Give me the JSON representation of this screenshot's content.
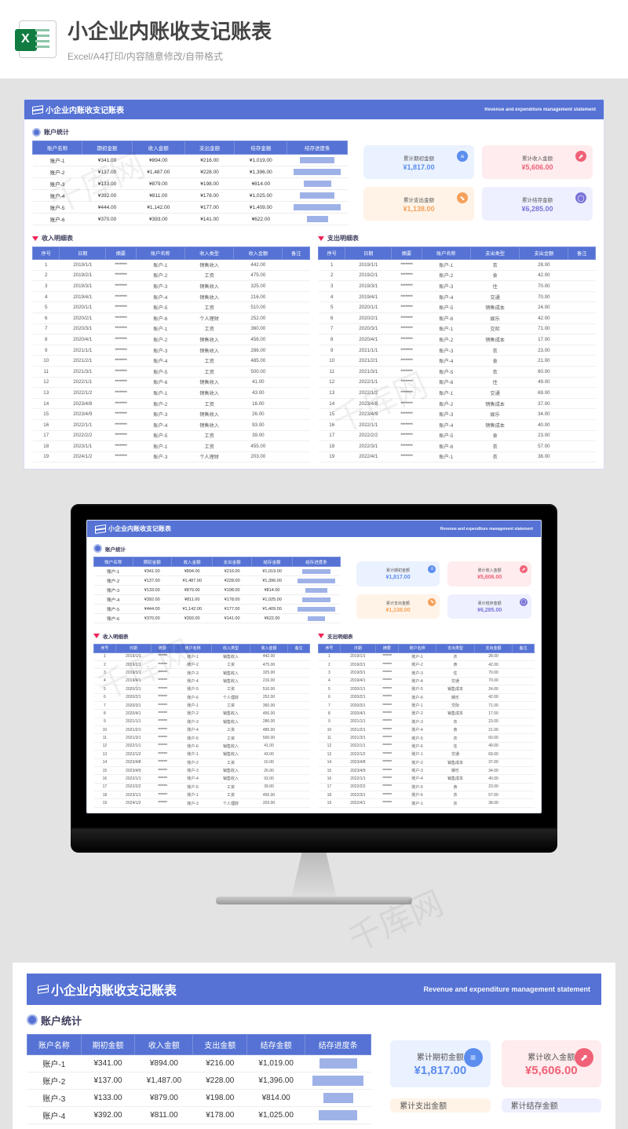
{
  "page": {
    "title": "小企业内账收支记账表",
    "subtitle": "Excel/A4打印/内容随意修改/自带格式",
    "watermark": "千库网"
  },
  "sheet": {
    "title": "小企业内账收支记账表",
    "title_en": "Revenue and expenditure management statement",
    "sect_acct": "账户统计",
    "sect_income": "收入明细表",
    "sect_expense": "支出明细表"
  },
  "acct": {
    "headers": [
      "账户名称",
      "期初金额",
      "收入金额",
      "支出金额",
      "结存金额",
      "结存进度条"
    ],
    "rows": [
      {
        "name": "账户-1",
        "a": "¥341.00",
        "b": "¥894.00",
        "c": "¥216.00",
        "d": "¥1,019.00",
        "bar": 60
      },
      {
        "name": "账户-2",
        "a": "¥137.00",
        "b": "¥1,487.00",
        "c": "¥228.00",
        "d": "¥1,396.00",
        "bar": 82
      },
      {
        "name": "账户-3",
        "a": "¥133.00",
        "b": "¥879.00",
        "c": "¥198.00",
        "d": "¥814.00",
        "bar": 48
      },
      {
        "name": "账户-4",
        "a": "¥392.00",
        "b": "¥811.00",
        "c": "¥178.00",
        "d": "¥1,025.00",
        "bar": 61
      },
      {
        "name": "账户-5",
        "a": "¥444.00",
        "b": "¥1,142.00",
        "c": "¥177.00",
        "d": "¥1,409.00",
        "bar": 83
      },
      {
        "name": "账户-6",
        "a": "¥370.00",
        "b": "¥393.00",
        "c": "¥141.00",
        "d": "¥622.00",
        "bar": 37
      }
    ]
  },
  "cards": [
    {
      "label": "累计期初金额",
      "value": "¥1,817.00",
      "icon": "≡"
    },
    {
      "label": "累计收入金额",
      "value": "¥5,606.00",
      "icon": "⬈"
    },
    {
      "label": "累计支出金额",
      "value": "¥1,138.00",
      "icon": "⬊"
    },
    {
      "label": "累计结存金额",
      "value": "¥6,285.00",
      "icon": "◯"
    }
  ],
  "income": {
    "headers": [
      "序号",
      "日期",
      "摘要",
      "账户名称",
      "收入类型",
      "收入金额",
      "备注"
    ],
    "rows": [
      {
        "n": 1,
        "d": "2019/1/1",
        "a": "账户-1",
        "t": "销售收入",
        "v": "442.00"
      },
      {
        "n": 2,
        "d": "2019/2/1",
        "a": "账户-2",
        "t": "工资",
        "v": "475.00"
      },
      {
        "n": 3,
        "d": "2019/3/1",
        "a": "账户-3",
        "t": "销售收入",
        "v": "325.00"
      },
      {
        "n": 4,
        "d": "2019/4/1",
        "a": "账户-4",
        "t": "销售收入",
        "v": "216.00"
      },
      {
        "n": 5,
        "d": "2020/1/1",
        "a": "账户-5",
        "t": "工资",
        "v": "510.00"
      },
      {
        "n": 6,
        "d": "2020/2/1",
        "a": "账户-6",
        "t": "个人理财",
        "v": "252.00"
      },
      {
        "n": 7,
        "d": "2020/3/1",
        "a": "账户-1",
        "t": "工资",
        "v": "360.00"
      },
      {
        "n": 8,
        "d": "2020/4/1",
        "a": "账户-2",
        "t": "销售收入",
        "v": "456.00"
      },
      {
        "n": 9,
        "d": "2021/1/1",
        "a": "账户-3",
        "t": "销售收入",
        "v": "286.00"
      },
      {
        "n": 10,
        "d": "2021/2/1",
        "a": "账户-4",
        "t": "工资",
        "v": "485.00"
      },
      {
        "n": 11,
        "d": "2021/3/1",
        "a": "账户-5",
        "t": "工资",
        "v": "500.00"
      },
      {
        "n": 12,
        "d": "2022/1/1",
        "a": "账户-6",
        "t": "销售收入",
        "v": "41.00"
      },
      {
        "n": 13,
        "d": "2022/1/2",
        "a": "账户-1",
        "t": "销售收入",
        "v": "43.00"
      },
      {
        "n": 14,
        "d": "2023/4/8",
        "a": "账户-2",
        "t": "工资",
        "v": "16.00"
      },
      {
        "n": 15,
        "d": "2023/4/9",
        "a": "账户-3",
        "t": "销售收入",
        "v": "26.00"
      },
      {
        "n": 16,
        "d": "2022/1/1",
        "a": "账户-4",
        "t": "销售收入",
        "v": "93.00"
      },
      {
        "n": 17,
        "d": "2022/2/2",
        "a": "账户-5",
        "t": "工资",
        "v": "39.00"
      },
      {
        "n": 18,
        "d": "2023/1/1",
        "a": "账户-1",
        "t": "工资",
        "v": "455.00"
      },
      {
        "n": 19,
        "d": "2024/1/2",
        "a": "账户-3",
        "t": "个人理财",
        "v": "203.00"
      }
    ]
  },
  "expense": {
    "headers": [
      "序号",
      "日期",
      "摘要",
      "账户名称",
      "支出类型",
      "支出金额",
      "备注"
    ],
    "rows": [
      {
        "n": 1,
        "d": "2019/1/1",
        "a": "账户-1",
        "t": "衣",
        "v": "28.00"
      },
      {
        "n": 2,
        "d": "2019/2/1",
        "a": "账户-2",
        "t": "食",
        "v": "42.00"
      },
      {
        "n": 3,
        "d": "2019/3/1",
        "a": "账户-3",
        "t": "住",
        "v": "70.00"
      },
      {
        "n": 4,
        "d": "2019/4/1",
        "a": "账户-4",
        "t": "交通",
        "v": "70.00"
      },
      {
        "n": 5,
        "d": "2020/1/1",
        "a": "账户-5",
        "t": "销售成本",
        "v": "24.00"
      },
      {
        "n": 6,
        "d": "2020/2/1",
        "a": "账户-6",
        "t": "娱乐",
        "v": "42.00"
      },
      {
        "n": 7,
        "d": "2020/3/1",
        "a": "账户-1",
        "t": "交际",
        "v": "71.00"
      },
      {
        "n": 8,
        "d": "2020/4/1",
        "a": "账户-2",
        "t": "销售成本",
        "v": "17.00"
      },
      {
        "n": 9,
        "d": "2021/1/1",
        "a": "账户-3",
        "t": "衣",
        "v": "23.00"
      },
      {
        "n": 10,
        "d": "2021/2/1",
        "a": "账户-4",
        "t": "食",
        "v": "21.00"
      },
      {
        "n": 11,
        "d": "2021/3/1",
        "a": "账户-5",
        "t": "衣",
        "v": "60.00"
      },
      {
        "n": 12,
        "d": "2022/1/1",
        "a": "账户-6",
        "t": "住",
        "v": "49.00"
      },
      {
        "n": 13,
        "d": "2022/1/2",
        "a": "账户-1",
        "t": "交通",
        "v": "69.00"
      },
      {
        "n": 14,
        "d": "2023/4/8",
        "a": "账户-2",
        "t": "销售成本",
        "v": "37.00"
      },
      {
        "n": 15,
        "d": "2023/4/9",
        "a": "账户-3",
        "t": "娱乐",
        "v": "34.00"
      },
      {
        "n": 16,
        "d": "2022/1/1",
        "a": "账户-4",
        "t": "销售成本",
        "v": "40.00"
      },
      {
        "n": 17,
        "d": "2022/2/2",
        "a": "账户-5",
        "t": "食",
        "v": "23.00"
      },
      {
        "n": 18,
        "d": "2022/3/1",
        "a": "账户-6",
        "t": "衣",
        "v": "57.00"
      },
      {
        "n": 19,
        "d": "2022/4/1",
        "a": "账户-1",
        "t": "衣",
        "v": "38.00"
      }
    ]
  },
  "chart_data": {
    "type": "bar",
    "title": "结存进度条",
    "categories": [
      "账户-1",
      "账户-2",
      "账户-3",
      "账户-4",
      "账户-5",
      "账户-6"
    ],
    "values": [
      1019,
      1396,
      814,
      1025,
      1409,
      622
    ],
    "xlabel": "",
    "ylabel": "结存金额",
    "ylim": [
      0,
      1600
    ]
  }
}
